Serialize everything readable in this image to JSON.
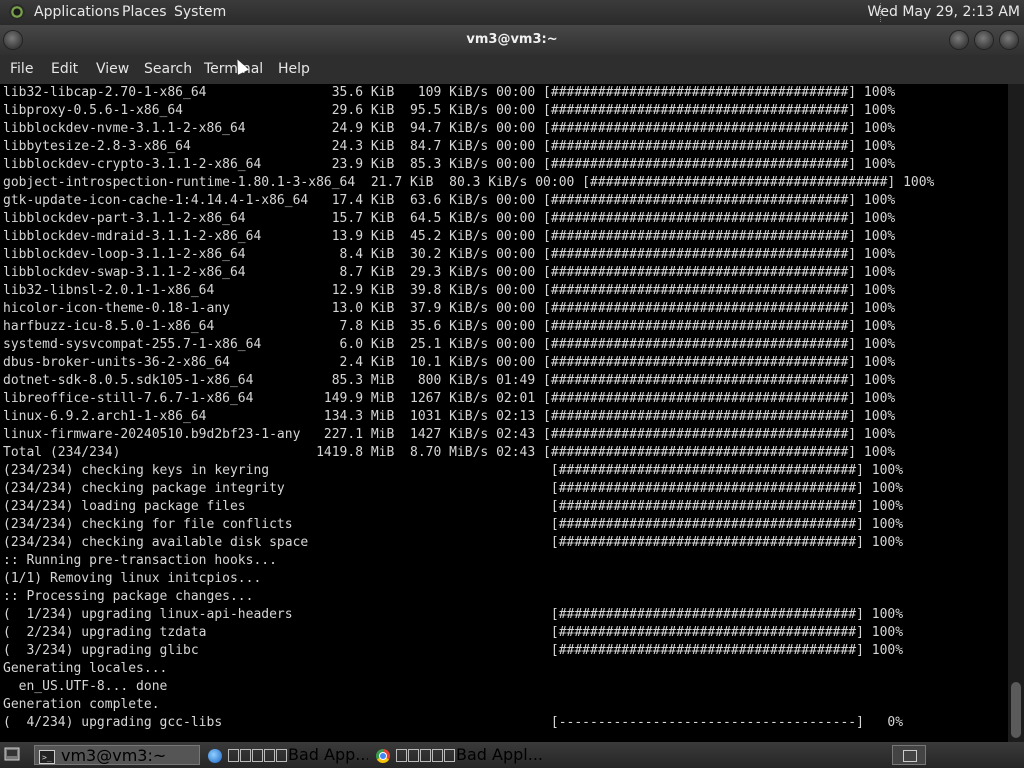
{
  "top_panel": {
    "menus": [
      "Applications",
      "Places",
      "System"
    ],
    "clock": "Wed May 29,  2:13 AM"
  },
  "window": {
    "title": "vm3@vm3:~"
  },
  "menubar": [
    "File",
    "Edit",
    "View",
    "Search",
    "Terminal",
    "Help"
  ],
  "terminal_lines": [
    "lib32-libcap-2.70-1-x86_64                35.6 KiB   109 KiB/s 00:00 [######################################] 100%",
    "libproxy-0.5.6-1-x86_64                   29.6 KiB  95.5 KiB/s 00:00 [######################################] 100%",
    "libblockdev-nvme-3.1.1-2-x86_64           24.9 KiB  94.7 KiB/s 00:00 [######################################] 100%",
    "libbytesize-2.8-3-x86_64                  24.3 KiB  84.7 KiB/s 00:00 [######################################] 100%",
    "libblockdev-crypto-3.1.1-2-x86_64         23.9 KiB  85.3 KiB/s 00:00 [######################################] 100%",
    "gobject-introspection-runtime-1.80.1-3-x86_64  21.7 KiB  80.3 KiB/s 00:00 [######################################] 100%",
    "gtk-update-icon-cache-1:4.14.4-1-x86_64   17.4 KiB  63.6 KiB/s 00:00 [######################################] 100%",
    "libblockdev-part-3.1.1-2-x86_64           15.7 KiB  64.5 KiB/s 00:00 [######################################] 100%",
    "libblockdev-mdraid-3.1.1-2-x86_64         13.9 KiB  45.2 KiB/s 00:00 [######################################] 100%",
    "libblockdev-loop-3.1.1-2-x86_64            8.4 KiB  30.2 KiB/s 00:00 [######################################] 100%",
    "libblockdev-swap-3.1.1-2-x86_64            8.7 KiB  29.3 KiB/s 00:00 [######################################] 100%",
    "lib32-libnsl-2.0.1-1-x86_64               12.9 KiB  39.8 KiB/s 00:00 [######################################] 100%",
    "hicolor-icon-theme-0.18-1-any             13.0 KiB  37.9 KiB/s 00:00 [######################################] 100%",
    "harfbuzz-icu-8.5.0-1-x86_64                7.8 KiB  35.6 KiB/s 00:00 [######################################] 100%",
    "systemd-sysvcompat-255.7-1-x86_64          6.0 KiB  25.1 KiB/s 00:00 [######################################] 100%",
    "dbus-broker-units-36-2-x86_64              2.4 KiB  10.1 KiB/s 00:00 [######################################] 100%",
    "dotnet-sdk-8.0.5.sdk105-1-x86_64          85.3 MiB   800 KiB/s 01:49 [######################################] 100%",
    "libreoffice-still-7.6.7-1-x86_64         149.9 MiB  1267 KiB/s 02:01 [######################################] 100%",
    "linux-6.9.2.arch1-1-x86_64               134.3 MiB  1031 KiB/s 02:13 [######################################] 100%",
    "linux-firmware-20240510.b9d2bf23-1-any   227.1 MiB  1427 KiB/s 02:43 [######################################] 100%",
    "Total (234/234)                         1419.8 MiB  8.70 MiB/s 02:43 [######################################] 100%",
    "(234/234) checking keys in keyring                                    [######################################] 100%",
    "(234/234) checking package integrity                                  [######################################] 100%",
    "(234/234) loading package files                                       [######################################] 100%",
    "(234/234) checking for file conflicts                                 [######################################] 100%",
    "(234/234) checking available disk space                               [######################################] 100%",
    ":: Running pre-transaction hooks...",
    "(1/1) Removing linux initcpios...",
    ":: Processing package changes...",
    "(  1/234) upgrading linux-api-headers                                 [######################################] 100%",
    "(  2/234) upgrading tzdata                                            [######################################] 100%",
    "(  3/234) upgrading glibc                                             [######################################] 100%",
    "Generating locales...",
    "  en_US.UTF-8... done",
    "Generation complete.",
    "(  4/234) upgrading gcc-libs                                          [--------------------------------------]   0%"
  ],
  "taskbar": {
    "terminal_task": "vm3@vm3:~",
    "browser_task_1": "Bad App...",
    "browser_task_2": "Bad Appl..."
  }
}
